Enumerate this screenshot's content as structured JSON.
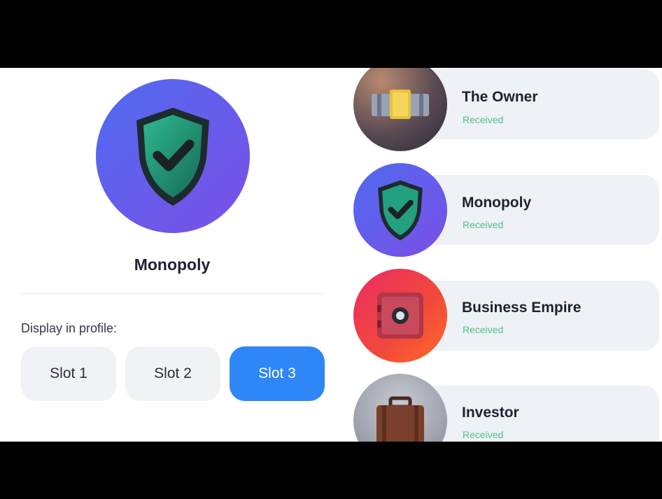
{
  "detail": {
    "title": "Monopoly",
    "display_label": "Display in profile:",
    "slots": [
      {
        "label": "Slot 1",
        "selected": false
      },
      {
        "label": "Slot 2",
        "selected": false
      },
      {
        "label": "Slot 3",
        "selected": true
      }
    ],
    "badge_icon": "shield-check-icon"
  },
  "achievements": [
    {
      "name": "The Owner",
      "status": "Received",
      "icon": "money-stack-icon"
    },
    {
      "name": "Monopoly",
      "status": "Received",
      "icon": "shield-check-icon"
    },
    {
      "name": "Business Empire",
      "status": "Received",
      "icon": "safe-icon"
    },
    {
      "name": "Investor",
      "status": "Received",
      "icon": "briefcase-icon"
    }
  ],
  "colors": {
    "accent": "#2f86f6",
    "status_received": "#4cc28a",
    "badge_gradient_start": "#4f6bf0",
    "badge_gradient_end": "#7b4fe6"
  }
}
